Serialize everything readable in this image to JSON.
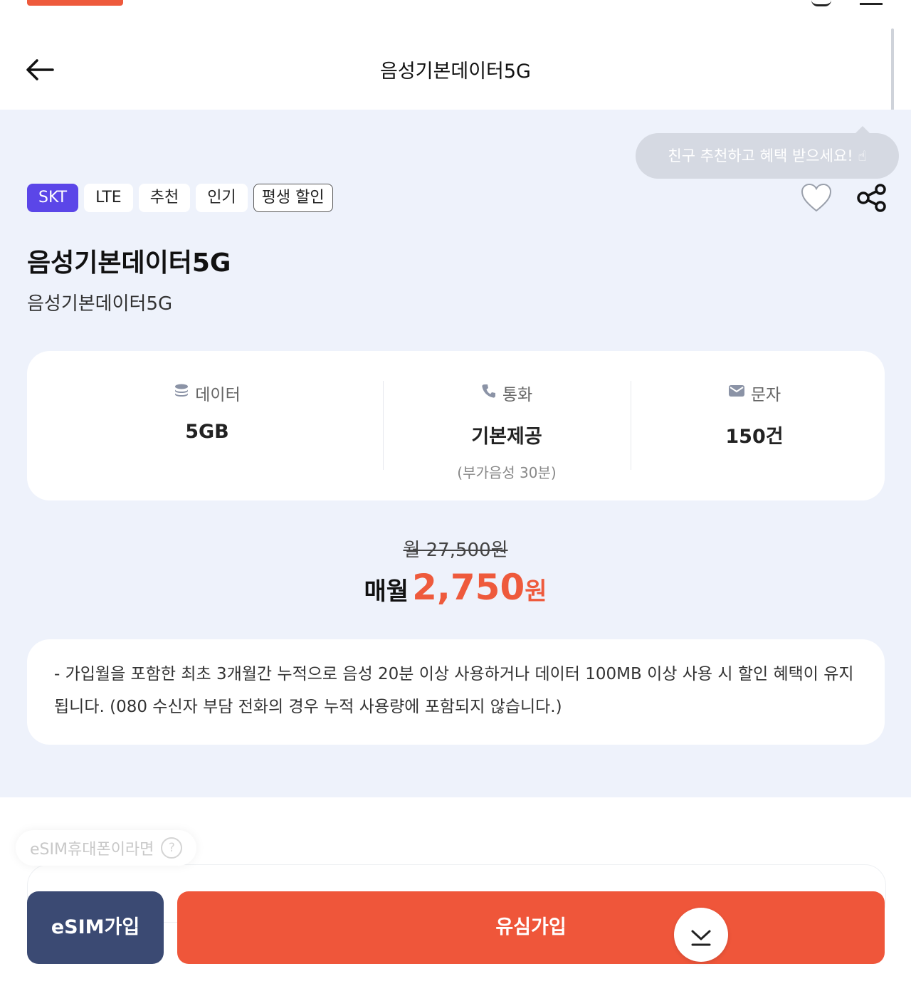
{
  "header": {
    "title": "음성기본데이터5G",
    "back_icon": "arrow-left-icon"
  },
  "tooltip": "친구 추천하고 혜택 받으세요!",
  "tags": [
    {
      "label": "SKT"
    },
    {
      "label": "LTE"
    },
    {
      "label": "추천"
    },
    {
      "label": "인기"
    },
    {
      "label": "평생 할인"
    }
  ],
  "plan": {
    "title": "음성기본데이터5G",
    "subtitle": "음성기본데이터5G"
  },
  "stats": {
    "data": {
      "label": "데이터",
      "value": "5GB",
      "icon": "database-icon"
    },
    "call": {
      "label": "통화",
      "value": "기본제공",
      "note": "(부가음성 30분)",
      "icon": "phone-icon"
    },
    "sms": {
      "label": "문자",
      "value": "150건",
      "icon": "mail-icon"
    }
  },
  "price": {
    "original": "월 27,500원",
    "prefix": "매월",
    "amount": "2,750",
    "unit": "원"
  },
  "notice": "- 가입월을 포함한 최초 3개월간 누적으로 음성 20분 이상 사용하거나 데이터 100MB 이상 사용 시 할인 혜택이 유지됩니다. (080 수신자 부담 전화의 경우 누적 사용량에 포함되지 않습니다.)",
  "esim_hint": {
    "label": "eSIM휴대폰이라면",
    "icon": "?"
  },
  "buttons": {
    "esim": "eSIM가입",
    "usim": "유심가입"
  },
  "colors": {
    "accent": "#ee5a3c",
    "skt_tag": "#5b46e8",
    "esim_button": "#3b4a73",
    "hero_bg": "#eef2fb"
  }
}
